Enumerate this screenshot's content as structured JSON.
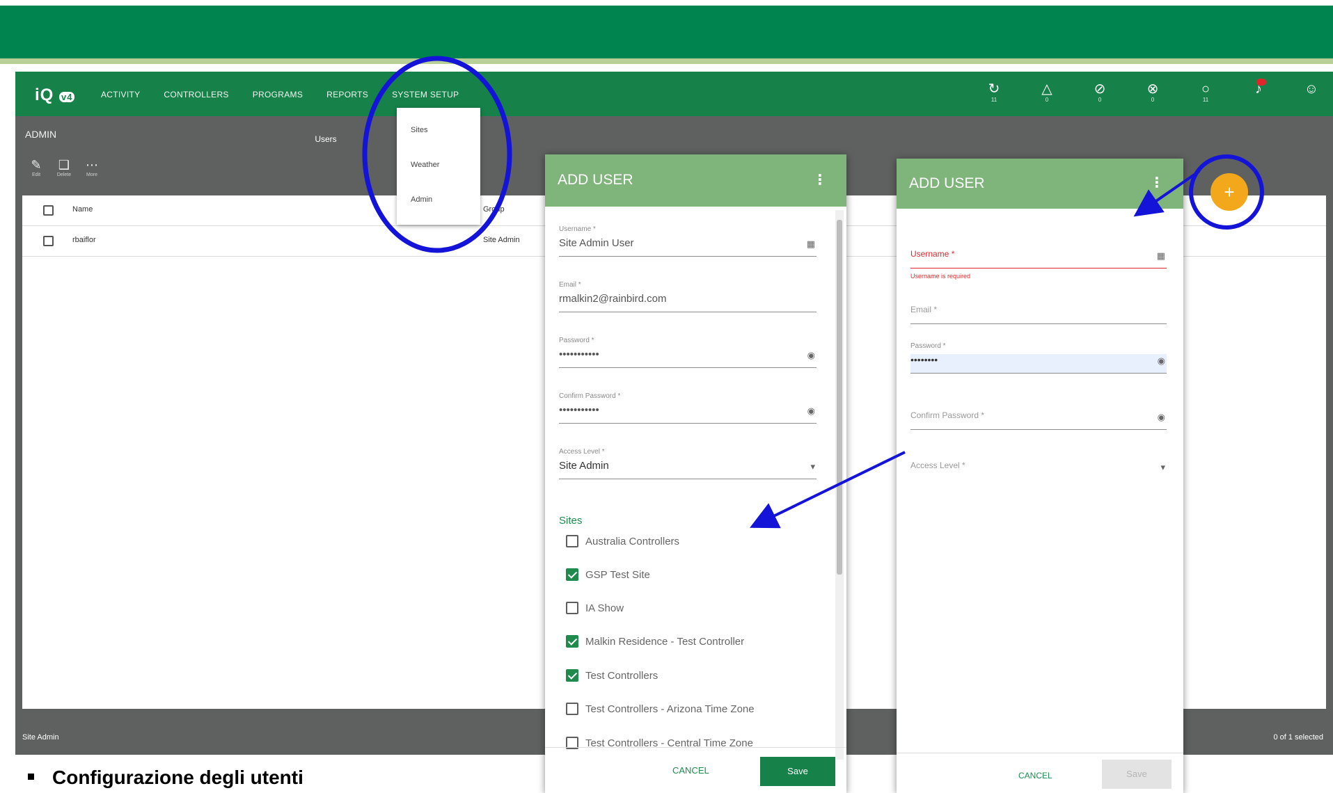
{
  "app": {
    "logo": "iQ",
    "logo_badge": "v4",
    "nav": [
      "ACTIVITY",
      "CONTROLLERS",
      "PROGRAMS",
      "REPORTS",
      "SYSTEM SETUP"
    ],
    "top_icons": [
      {
        "icon": "sync-icon",
        "glyph": "↻",
        "count": "11"
      },
      {
        "icon": "warning-icon",
        "glyph": "△",
        "count": "0"
      },
      {
        "icon": "blocked-icon",
        "glyph": "⊘",
        "count": "0"
      },
      {
        "icon": "offline-icon",
        "glyph": "⊗",
        "count": "0"
      },
      {
        "icon": "bulb-icon",
        "glyph": "○",
        "count": "11"
      },
      {
        "icon": "bell-icon",
        "glyph": "♪",
        "count": ""
      },
      {
        "icon": "user-icon",
        "glyph": "☺",
        "count": ""
      }
    ],
    "page_title": "ADMIN",
    "tab": "Users",
    "tools": [
      {
        "icon": "edit-icon",
        "glyph": "✎",
        "label": "Edit"
      },
      {
        "icon": "delete-icon",
        "glyph": "❑",
        "label": "Delete"
      },
      {
        "icon": "more-icon",
        "glyph": "⋯",
        "label": "More"
      }
    ],
    "table": {
      "header_name": "Name",
      "header_group": "Group",
      "rows": [
        {
          "name": "rbaiflor",
          "group": "Site Admin"
        }
      ]
    },
    "status_left": "Site Admin",
    "status_right": "0 of 1 selected"
  },
  "dropdown": {
    "items": [
      "Sites",
      "Weather",
      "Admin"
    ]
  },
  "dialog_left": {
    "title": "ADD USER",
    "fields": [
      {
        "label": "Username *",
        "value": "Site Admin User"
      },
      {
        "label": "Email *",
        "value": "rmalkin2@rainbird.com"
      },
      {
        "label": "Password *",
        "value": "•••••••••••"
      },
      {
        "label": "Confirm Password *",
        "value": "•••••••••••"
      },
      {
        "label": "Access Level *",
        "value": "Site Admin"
      }
    ],
    "sites_label": "Sites",
    "sites": [
      {
        "label": "Australia Controllers",
        "checked": false
      },
      {
        "label": "GSP Test Site",
        "checked": true
      },
      {
        "label": "IA Show",
        "checked": false
      },
      {
        "label": "Malkin Residence - Test Controller",
        "checked": true
      },
      {
        "label": "Test Controllers",
        "checked": true
      },
      {
        "label": "Test Controllers - Arizona Time Zone",
        "checked": false
      },
      {
        "label": "Test Controllers - Central Time Zone",
        "checked": false
      }
    ],
    "cancel": "CANCEL",
    "save": "Save"
  },
  "dialog_right": {
    "title": "ADD USER",
    "username_label": "Username *",
    "username_error": "Username is required",
    "email_label": "Email *",
    "password_label": "Password *",
    "password_value": "••••••••",
    "confirm_label": "Confirm Password *",
    "access_label": "Access Level *",
    "cancel": "CANCEL",
    "save": "Save"
  },
  "fab_label": "+",
  "caption": "Configurazione degli utenti",
  "colors": {
    "brand_green": "#17814a",
    "header_green": "#7fb47b",
    "accent_orange": "#f3a81c",
    "error_red": "#e0262a",
    "annotation_blue": "#1414d8"
  }
}
